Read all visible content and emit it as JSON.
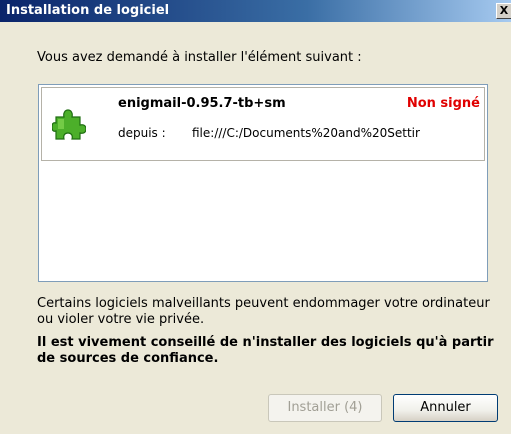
{
  "window": {
    "title": "Installation de logiciel",
    "close_glyph": "X"
  },
  "intro_text": "Vous avez demandé à installer l'élément suivant :",
  "item": {
    "name": "enigmail-0.95.7-tb+sm",
    "status": "Non signé",
    "status_color": "#e00000",
    "from_label": "depuis :",
    "from_value": "file:///C:/Documents%20and%20Settir",
    "icon": "puzzle-piece-icon"
  },
  "warning_text": "Certains logiciels malveillants peuvent endommager votre ordinateur ou violer votre vie privée.",
  "strong_warning_text": "Il est vivement conseillé de n'installer des logiciels qu'à partir de sources de confiance.",
  "buttons": {
    "install_label": "Installer (4)",
    "cancel_label": "Annuler"
  }
}
